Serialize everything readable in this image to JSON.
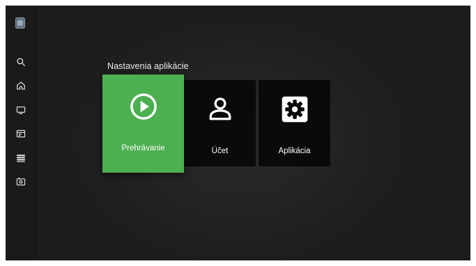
{
  "app": {
    "section_title": "Nastavenia aplikácie"
  },
  "sidebar": {
    "items": [
      {
        "icon": "search-icon"
      },
      {
        "icon": "home-icon"
      },
      {
        "icon": "tv-icon"
      },
      {
        "icon": "tv-guide-icon"
      },
      {
        "icon": "list-icon"
      },
      {
        "icon": "recordings-icon"
      }
    ]
  },
  "tiles": [
    {
      "label": "Prehrávanie",
      "icon": "play-circle-icon",
      "selected": true
    },
    {
      "label": "Účet",
      "icon": "account-icon",
      "selected": false
    },
    {
      "label": "Aplikácia",
      "icon": "settings-gear-icon",
      "selected": false
    }
  ],
  "colors": {
    "accent": "#4caf50",
    "tile_background": "#0a0a0a",
    "screen_background": "#232323",
    "text": "#ffffff"
  }
}
